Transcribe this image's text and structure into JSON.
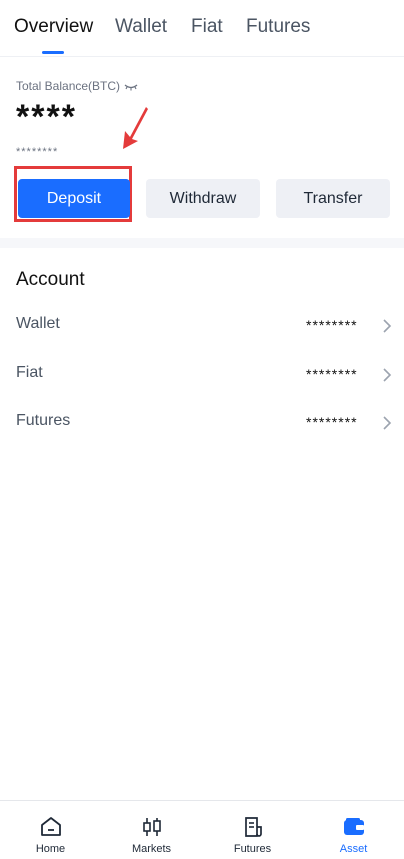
{
  "tabs": [
    {
      "label": "Overview",
      "active": true
    },
    {
      "label": "Wallet",
      "active": false
    },
    {
      "label": "Fiat",
      "active": false
    },
    {
      "label": "Futures",
      "active": false
    }
  ],
  "balance": {
    "label": "Total Balance(BTC)",
    "value": "****",
    "sub_value": "********"
  },
  "actions": {
    "deposit": "Deposit",
    "withdraw": "Withdraw",
    "transfer": "Transfer"
  },
  "account": {
    "title": "Account",
    "rows": [
      {
        "label": "Wallet",
        "value": "********"
      },
      {
        "label": "Fiat",
        "value": "********"
      },
      {
        "label": "Futures",
        "value": "********"
      }
    ]
  },
  "bottom_nav": [
    {
      "label": "Home",
      "icon": "home-icon",
      "active": false
    },
    {
      "label": "Markets",
      "icon": "candlestick-icon",
      "active": false
    },
    {
      "label": "Futures",
      "icon": "document-icon",
      "active": false
    },
    {
      "label": "Asset",
      "icon": "wallet-icon",
      "active": true
    }
  ],
  "colors": {
    "accent": "#1a6dff",
    "highlight": "#e43b3b",
    "button_secondary": "#eef0f5"
  }
}
